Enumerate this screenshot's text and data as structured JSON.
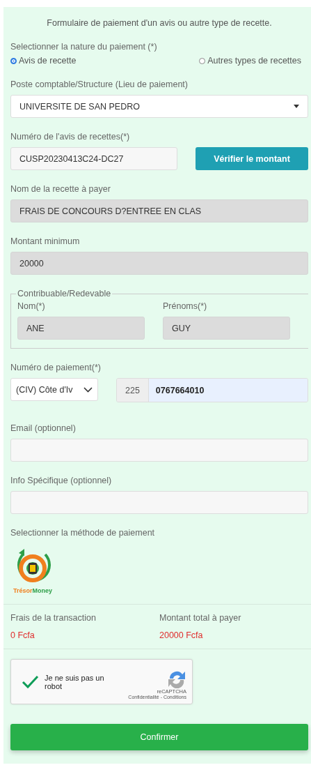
{
  "form": {
    "title": "Formulaire de paiement d'un avis ou autre type de recette.",
    "nature": {
      "label": "Selectionner la nature du paiement (*)",
      "options": [
        {
          "label": "Avis de recette",
          "selected": true
        },
        {
          "label": "Autres types de recettes",
          "selected": false
        }
      ]
    },
    "poste": {
      "label": "Poste comptable/Structure (Lieu de paiement)",
      "value": "UNIVERSITE DE SAN PEDRO"
    },
    "avis": {
      "label": "Numéro de l'avis de recettes(*)",
      "value": "CUSP20230413C24-DC27",
      "button": "Vérifier le montant"
    },
    "recette": {
      "label": "Nom de la recette à payer",
      "value": "FRAIS DE CONCOURS D?ENTREE EN CLAS"
    },
    "montant": {
      "label": "Montant minimum",
      "value": "20000"
    },
    "contribuable": {
      "legend": "Contribuable/Redevable",
      "fields": [
        {
          "label": "Nom(*)",
          "value": "ANE"
        },
        {
          "label": "Prénoms(*)",
          "value": "GUY"
        }
      ]
    },
    "paiement": {
      "label": "Numéro de paiement(*)",
      "country": "(CIV) Côte d'Iv",
      "code": "225",
      "number": "0767664010"
    },
    "email": {
      "label": "Email (optionnel)"
    },
    "info": {
      "label": "Info Spécifique (optionnel)"
    },
    "methode": {
      "label": "Selectionner la méthode de paiement",
      "logo_parts": [
        {
          "text": "Trésor",
          "color": "#f07f1e"
        },
        {
          "text": "Money",
          "color": "#2e9e48"
        }
      ]
    },
    "summary": [
      {
        "label": "Frais de la transaction",
        "value": "0 Fcfa"
      },
      {
        "label": "Montant total à payer",
        "value": "20000 Fcfa"
      }
    ],
    "captcha": {
      "checked": true,
      "label": "Je ne suis pas un robot",
      "brand": "reCAPTCHA",
      "links": "Confidentialité - Conditions"
    },
    "confirm": "Confirmer"
  }
}
